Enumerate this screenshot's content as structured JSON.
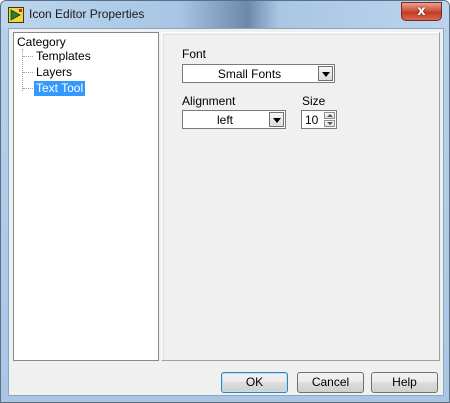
{
  "window": {
    "title": "Icon Editor Properties",
    "close_glyph": "x"
  },
  "category": {
    "header": "Category",
    "items": [
      {
        "label": "Templates",
        "selected": false
      },
      {
        "label": "Layers",
        "selected": false
      },
      {
        "label": "Text Tool",
        "selected": true
      }
    ]
  },
  "settings": {
    "font": {
      "label": "Font",
      "value": "Small Fonts"
    },
    "alignment": {
      "label": "Alignment",
      "value": "left"
    },
    "size": {
      "label": "Size",
      "value": "10"
    }
  },
  "buttons": {
    "ok": "OK",
    "cancel": "Cancel",
    "help": "Help"
  },
  "colors": {
    "selection": "#3399ff",
    "close_button": "#c23a22"
  }
}
